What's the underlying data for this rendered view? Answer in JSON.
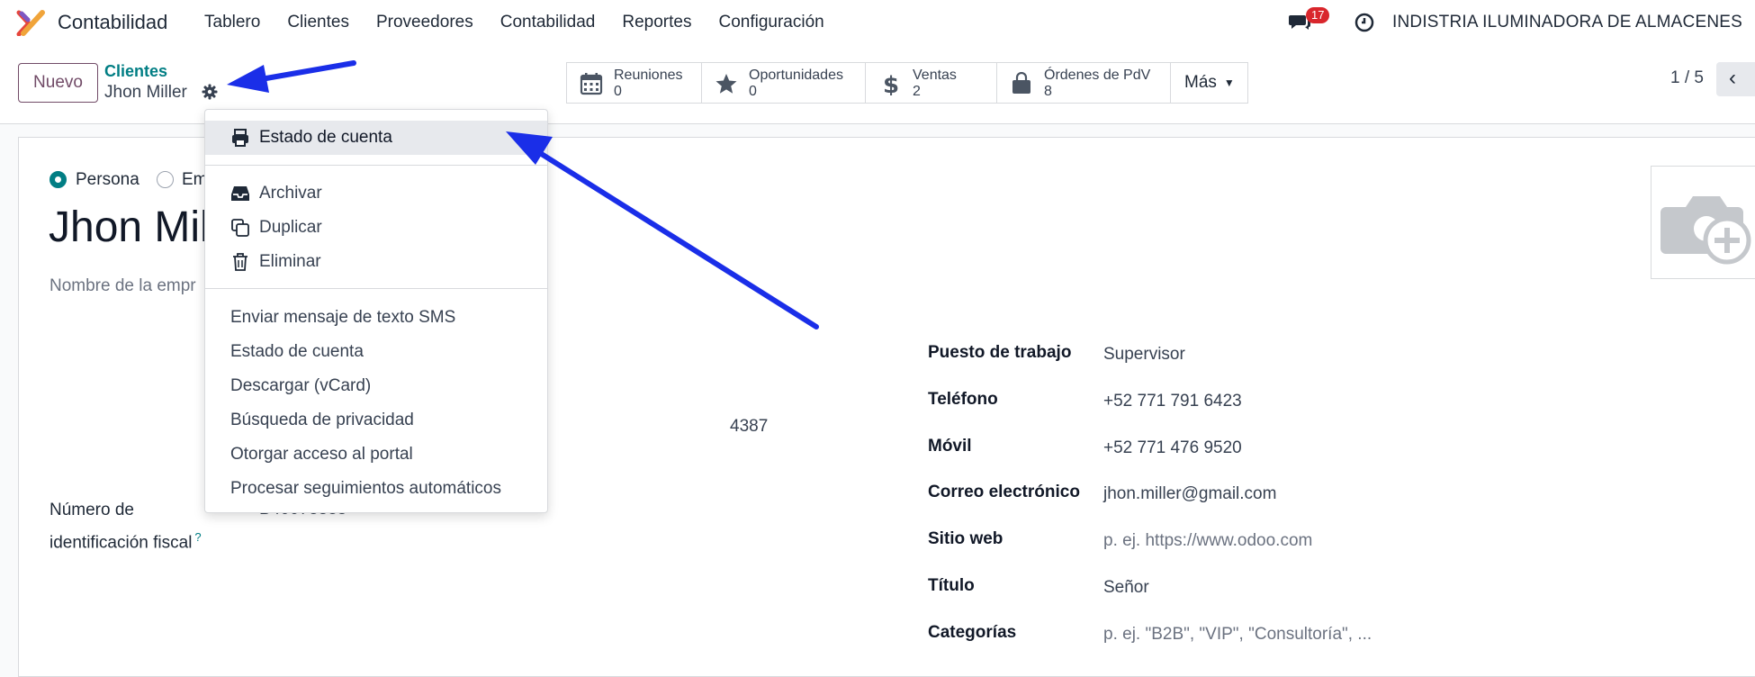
{
  "app": {
    "name": "Contabilidad",
    "brand_color": "#714b67",
    "accent_color": "#017e84"
  },
  "topnav": {
    "items": [
      "Tablero",
      "Clientes",
      "Proveedores",
      "Contabilidad",
      "Reportes",
      "Configuración"
    ],
    "messages_badge": "17",
    "company": "INDISTRIA ILUMINADORA DE ALMACENES"
  },
  "controlbar": {
    "new_button": "Nuevo",
    "breadcrumb_parent": "Clientes",
    "breadcrumb_current": "Jhon Miller",
    "pager": "1 / 5",
    "pager_prev": "‹",
    "more_button": "Más"
  },
  "smart_buttons": [
    {
      "label": "Reuniones",
      "count": "0",
      "icon": "calendar-icon"
    },
    {
      "label": "Oportunidades",
      "count": "0",
      "icon": "star-icon"
    },
    {
      "label": "Ventas",
      "count": "2",
      "icon": "dollar-icon"
    },
    {
      "label": "Órdenes de PdV",
      "count": "8",
      "icon": "shopping-bag-icon"
    }
  ],
  "form": {
    "radio_person": "Persona",
    "radio_company": "Em",
    "name": "Jhon Mil",
    "company_placeholder": "Nombre de la empr",
    "partial_value": "4387",
    "tax_label_line1": "Número de",
    "tax_label_line2": "identificación fiscal",
    "tax_help": "?",
    "tax_value": "B40073838",
    "fields": [
      {
        "label": "Puesto de trabajo",
        "value": "Supervisor",
        "placeholder": false
      },
      {
        "label": "Teléfono",
        "value": "+52 771 791 6423",
        "placeholder": false
      },
      {
        "label": "Móvil",
        "value": "+52 771 476 9520",
        "placeholder": false
      },
      {
        "label": "Correo electrónico",
        "value": "jhon.miller@gmail.com",
        "placeholder": false
      },
      {
        "label": "Sitio web",
        "value": "p. ej. https://www.odoo.com",
        "placeholder": true
      },
      {
        "label": "Título",
        "value": "Señor",
        "placeholder": false
      },
      {
        "label": "Categorías",
        "value": "p. ej. \"B2B\", \"VIP\", \"Consultoría\", ...",
        "placeholder": true
      }
    ]
  },
  "gear_menu": {
    "print_items": [
      "Estado de cuenta"
    ],
    "record_items": [
      "Archivar",
      "Duplicar",
      "Eliminar"
    ],
    "action_items": [
      "Enviar mensaje de texto SMS",
      "Estado de cuenta",
      "Descargar (vCard)",
      "Búsqueda de privacidad",
      "Otorgar acceso al portal",
      "Procesar seguimientos automáticos"
    ]
  },
  "annotation": {
    "arrow_color": "#1a2ee8"
  }
}
